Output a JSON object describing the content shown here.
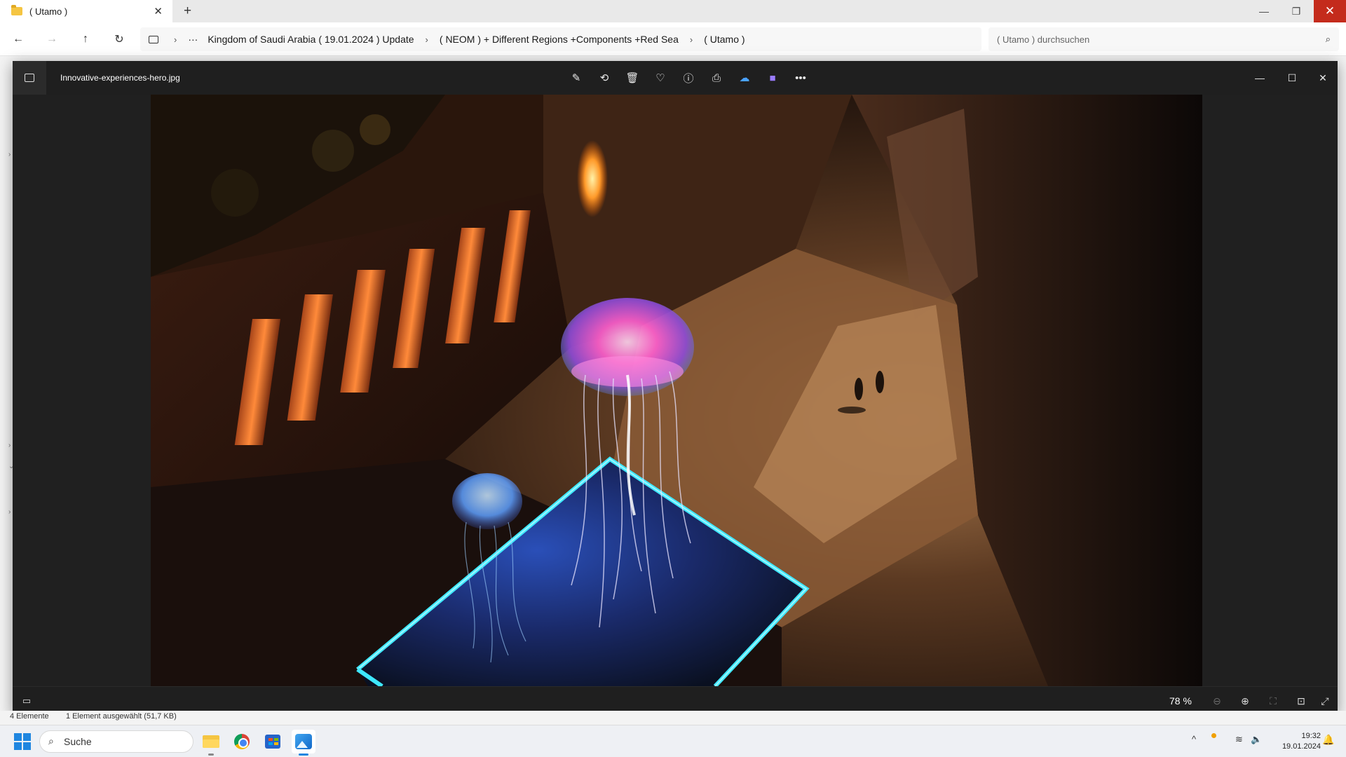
{
  "explorer": {
    "tab_title": "( Utamo )",
    "breadcrumb": [
      "Kingdom of Saudi Arabia ( 19.01.2024 ) Update",
      "( NEOM ) + Different Regions +Components +Red Sea",
      "( Utamo )"
    ],
    "search_placeholder": "( Utamo ) durchsuchen",
    "status_items": "4 Elemente",
    "status_selected": "1 Element ausgewählt (51,7 KB)"
  },
  "photos": {
    "filename": "Innovative-experiences-hero.jpg",
    "toolbar": [
      "edit-image",
      "rotate",
      "delete",
      "favorite",
      "info",
      "print",
      "onedrive",
      "clipchamp",
      "more"
    ],
    "zoom": "78 %"
  },
  "taskbar": {
    "search_label": "Suche",
    "apps": [
      "file-explorer",
      "chrome",
      "microsoft-store",
      "photos"
    ],
    "active_app": "photos",
    "time": "19:32",
    "date": "19.01.2024"
  },
  "colors": {
    "close_red": "#c42b1c",
    "photos_bg": "#202020",
    "neon_cyan": "#3ee8ff",
    "jelly_pink": "#ff5fd0",
    "windows_blue": "#1f86e0"
  }
}
